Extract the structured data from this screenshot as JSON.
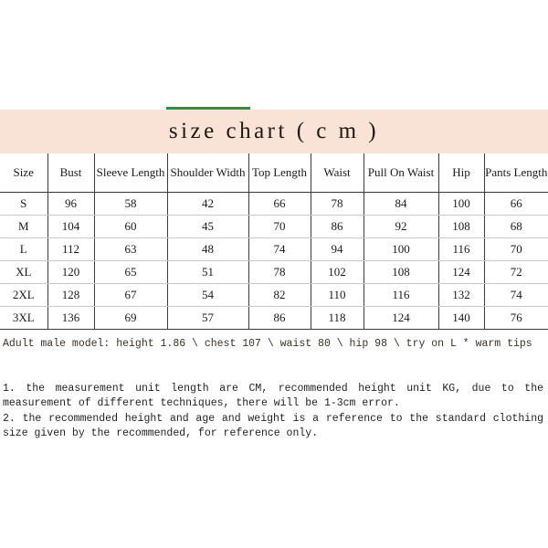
{
  "title": "size chart ( c m )",
  "accent_color": "#1a9b3c",
  "band_color": "#f9e3d7",
  "table": {
    "headers": [
      "Size",
      "Bust",
      "Sleeve\nLength",
      "Shoulder\nWidth",
      "Top\nLength",
      "Waist",
      "Pull On\nWaist",
      "Hip",
      "Pants\nLength"
    ],
    "rows": [
      {
        "size": "S",
        "bust": "96",
        "sleeve_length": "58",
        "shoulder_width": "42",
        "top_length": "66",
        "waist": "78",
        "pull_on_waist": "84",
        "hip": "100",
        "pants_length": "66"
      },
      {
        "size": "M",
        "bust": "104",
        "sleeve_length": "60",
        "shoulder_width": "45",
        "top_length": "70",
        "waist": "86",
        "pull_on_waist": "92",
        "hip": "108",
        "pants_length": "68"
      },
      {
        "size": "L",
        "bust": "112",
        "sleeve_length": "63",
        "shoulder_width": "48",
        "top_length": "74",
        "waist": "94",
        "pull_on_waist": "100",
        "hip": "116",
        "pants_length": "70"
      },
      {
        "size": "XL",
        "bust": "120",
        "sleeve_length": "65",
        "shoulder_width": "51",
        "top_length": "78",
        "waist": "102",
        "pull_on_waist": "108",
        "hip": "124",
        "pants_length": "72"
      },
      {
        "size": "2XL",
        "bust": "128",
        "sleeve_length": "67",
        "shoulder_width": "54",
        "top_length": "82",
        "waist": "110",
        "pull_on_waist": "116",
        "hip": "132",
        "pants_length": "74"
      },
      {
        "size": "3XL",
        "bust": "136",
        "sleeve_length": "69",
        "shoulder_width": "57",
        "top_length": "86",
        "waist": "118",
        "pull_on_waist": "124",
        "hip": "140",
        "pants_length": "76"
      }
    ]
  },
  "model_note": "Adult male model: height 1.86 \\ chest 107 \\ waist 80 \\ hip 98 \\ try on L * warm tips",
  "notes": [
    "1. the measurement unit length are CM, recommended height unit KG, due to the measurement of different techniques, there will be 1-3cm error.",
    "2. the recommended height and age and weight is a reference to the standard clothing size given by the recommended, for reference only."
  ]
}
